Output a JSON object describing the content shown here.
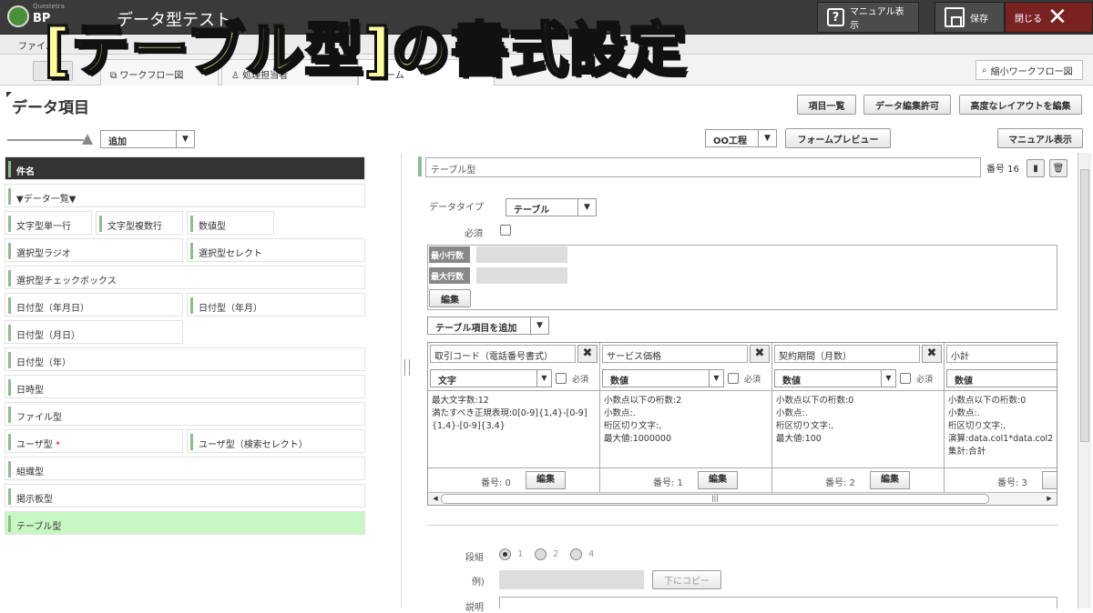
{
  "topbar": {
    "logo_text": "BP",
    "logo_sub": "Questetra",
    "app_title": "データ型テスト",
    "manual_label": "マニュアル表示",
    "save_label": "保存",
    "close_label": "閉じる"
  },
  "overlay_title": "[テーブル型]の書式設定",
  "menubar": {
    "file": "ファイル"
  },
  "tabs": {
    "back": "⇦",
    "workflow": "ワークフロー図",
    "other": "処理担当者",
    "form": "フォーム"
  },
  "mini_workflow": "縮小ワークフロー図",
  "section_title": "データ項目",
  "header_buttons": {
    "list": "項目一覧",
    "edit_perm": "データ編集許可",
    "advanced": "高度なレイアウトを編集"
  },
  "add_select": "追加",
  "process_select": "OO工程",
  "form_preview": "フォームプレビュー",
  "manual_btn": "マニュアル表示",
  "left_items": {
    "title": "件名",
    "list_header": "▼データ一覧▼",
    "str1": "文字型単一行",
    "strm": "文字型複数行",
    "num": "数値型",
    "radio": "選択型ラジオ",
    "select": "選択型セレクト",
    "check": "選択型チェックボックス",
    "date_ymd": "日付型（年月日）",
    "date_ym": "日付型（年月）",
    "date_md": "日付型（月日）",
    "date_y": "日付型（年）",
    "datetime": "日時型",
    "file": "ファイル型",
    "user": "ユーザ型",
    "user_req": "*",
    "user_search": "ユーザ型（検索セレクト）",
    "org": "組織型",
    "board": "掲示板型",
    "table": "テーブル型"
  },
  "field": {
    "name": "テーブル型",
    "number_label": "番号 16",
    "datatype_label": "データタイプ",
    "datatype_value": "テーブル",
    "required_label": "必須",
    "min_rows": "最小行数",
    "max_rows": "最大行数",
    "edit": "編集",
    "add_col": "テーブル項目を追加"
  },
  "columns": [
    {
      "name": "取引コード（電話番号書式）",
      "type": "文字",
      "required": "必須",
      "desc": "最大文字数:12\n満たすべき正規表現:0[0-9]{1,4}-[0-9]{1,4}-[0-9]{3,4}",
      "number": "番号: 0",
      "edit": "編集"
    },
    {
      "name": "サービス価格",
      "type": "数値",
      "required": "必須",
      "desc": "小数点以下の桁数:2\n小数点:.\n桁区切り文字:,\n最大値:1000000",
      "number": "番号: 1",
      "edit": "編集"
    },
    {
      "name": "契約期間（月数）",
      "type": "数値",
      "required": "必須",
      "desc": "小数点以下の桁数:0\n小数点:.\n桁区切り文字:,\n最大値:100",
      "number": "番号: 2",
      "edit": "編集"
    },
    {
      "name": "小計",
      "type": "数値",
      "required": "",
      "desc": "小数点以下の桁数:0\n小数点:.\n桁区切り文字:,\n演算:data.col1*data.col2\n集計:合計",
      "number": "番号: 3",
      "edit": "編"
    }
  ],
  "bottom": {
    "layout_label": "段組",
    "opt1": "1",
    "opt2": "2",
    "opt4": "4",
    "example_label": "例)",
    "copy_btn": "下にコピー",
    "desc_label": "説明"
  }
}
